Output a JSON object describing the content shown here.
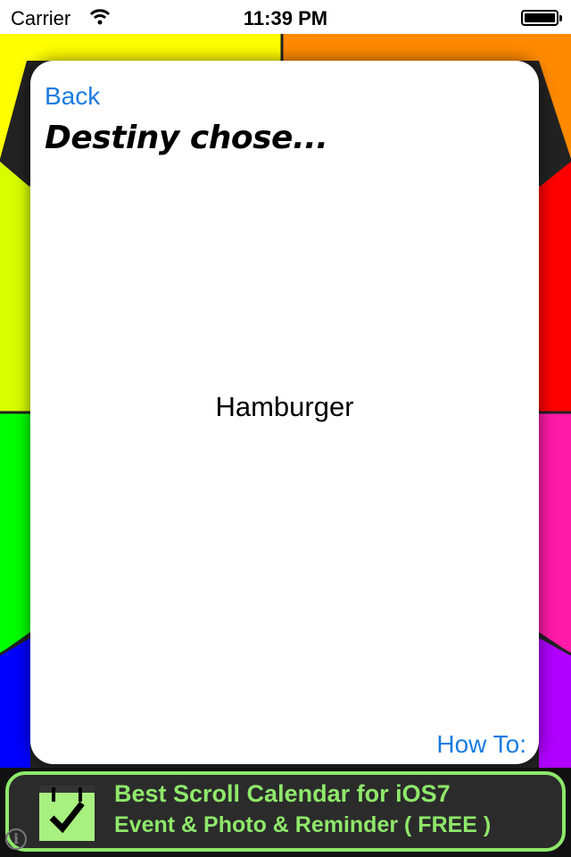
{
  "status_bar": {
    "carrier": "Carrier",
    "time": "11:39 PM"
  },
  "wheel_colors": [
    "#ffff00",
    "#ff8a00",
    "#d8ff00",
    "#ff0000",
    "#00ff00",
    "#ff1aa8",
    "#0000ff",
    "#b000ff"
  ],
  "card": {
    "back_label": "Back",
    "heading": "Destiny chose...",
    "result": "Hamburger",
    "howto_label": "How To:"
  },
  "ad": {
    "line1": "Best Scroll Calendar for iOS7",
    "line2": "Event & Photo & Reminder ( FREE )",
    "info_glyph": "i",
    "accent": "#8ee86a"
  }
}
